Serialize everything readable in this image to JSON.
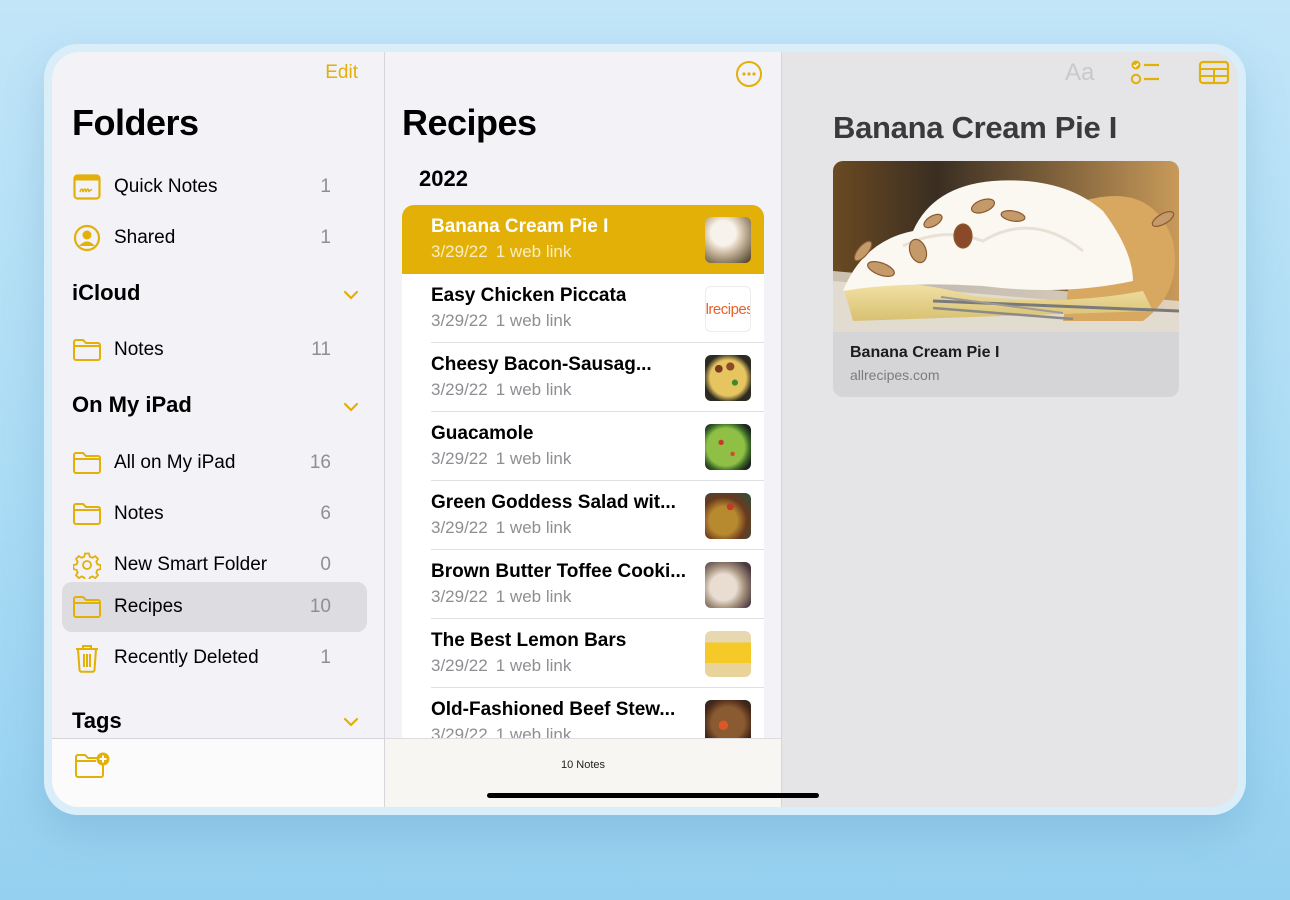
{
  "colors": {
    "accent": "#e2b007",
    "background": "#f2f2f7",
    "secondary_text": "#8e8e93"
  },
  "sidebar": {
    "edit_label": "Edit",
    "title": "Folders",
    "pinned": [
      {
        "label": "Quick Notes",
        "count": "1",
        "icon": "quick-notes-icon"
      },
      {
        "label": "Shared",
        "count": "1",
        "icon": "shared-person-icon"
      }
    ],
    "sections": [
      {
        "title": "iCloud",
        "items": [
          {
            "label": "Notes",
            "count": "11",
            "icon": "folder-icon"
          }
        ]
      },
      {
        "title": "On My iPad",
        "items": [
          {
            "label": "All on My iPad",
            "count": "16",
            "icon": "folder-icon"
          },
          {
            "label": "Notes",
            "count": "6",
            "icon": "folder-icon"
          },
          {
            "label": "New Smart Folder",
            "count": "0",
            "icon": "gear-icon"
          },
          {
            "label": "Recipes",
            "count": "10",
            "icon": "folder-icon",
            "selected": true
          },
          {
            "label": "Recently Deleted",
            "count": "1",
            "icon": "trash-icon"
          }
        ]
      },
      {
        "title": "Tags",
        "items": []
      }
    ],
    "footer": {
      "new_folder_icon": "new-folder-icon"
    }
  },
  "notelist": {
    "title": "Recipes",
    "more_icon": "ellipsis-circle-icon",
    "group_header": "2022",
    "notes": [
      {
        "title": "Banana Cream Pie I",
        "date": "3/29/22",
        "meta": "1 web link",
        "selected": true,
        "thumb": "banana-cream-pie"
      },
      {
        "title": "Easy Chicken Piccata",
        "date": "3/29/22",
        "meta": "1 web link",
        "thumb": "allrecipes-logo"
      },
      {
        "title": "Cheesy Bacon-Sausag...",
        "date": "3/29/22",
        "meta": "1 web link",
        "thumb": "casserole"
      },
      {
        "title": "Guacamole",
        "date": "3/29/22",
        "meta": "1 web link",
        "thumb": "guacamole"
      },
      {
        "title": "Green Goddess Salad wit...",
        "date": "3/29/22",
        "meta": "1 web link",
        "thumb": "salad"
      },
      {
        "title": "Brown Butter Toffee Cooki...",
        "date": "3/29/22",
        "meta": "1 web link",
        "thumb": "cookies"
      },
      {
        "title": "The Best Lemon Bars",
        "date": "3/29/22",
        "meta": "1 web link",
        "thumb": "lemon-bars"
      },
      {
        "title": "Old-Fashioned Beef Stew...",
        "date": "3/29/22",
        "meta": "1 web link",
        "thumb": "beef-stew"
      }
    ],
    "thumb_logo_text": "llrecipes",
    "footer_count": "10 Notes"
  },
  "detail": {
    "toolbar": {
      "format_label": "Aa",
      "checklist_icon": "checklist-icon",
      "table_icon": "table-icon"
    },
    "heading": "Banana Cream Pie I",
    "link_card": {
      "title": "Banana Cream Pie I",
      "domain": "allrecipes.com"
    }
  }
}
